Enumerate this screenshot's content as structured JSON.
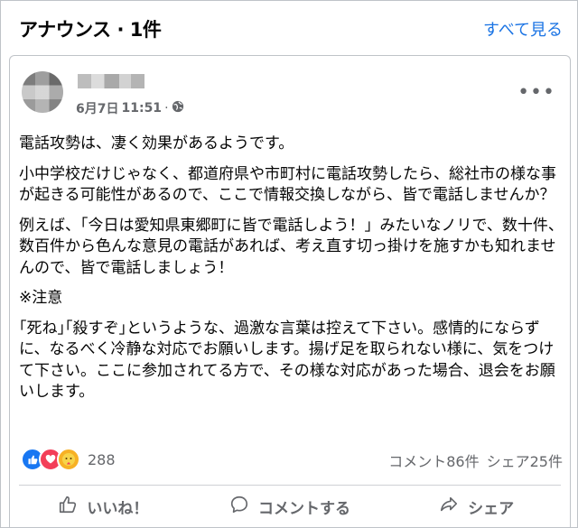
{
  "header": {
    "title": "アナウンス · 1件",
    "see_all": "すべて見る"
  },
  "post": {
    "date": "6月7日",
    "time": "11:51",
    "separator": "·",
    "paragraphs": [
      "電話攻勢は、凄く効果があるようです。",
      "小中学校だけじゃなく、都道府県や市町村に電話攻勢したら、総社市の様な事が起きる可能性があるので、ここで情報交換しながら、皆で電話しませんか？",
      "例えば、「今日は愛知県東郷町に皆で電話しよう！」みたいなノリで、数十件、数百件から色んな意見の電話があれば、考え直す切っ掛けを施すかも知れませんので、皆で電話しましょう！",
      "※注意",
      "｢死ね｣｢殺すぞ｣というような、過激な言葉は控えて下さい。感情的にならずに、なるべく冷静な対応でお願いします。揚げ足を取られない様に、気をつけて下さい。ここに参加されてる方で、その様な対応があった場合、退会をお願いします。"
    ],
    "reaction_count": "288",
    "comments": "コメント86件",
    "shares": "シェア25件"
  },
  "actions": {
    "like": "いいね！",
    "comment": "コメントする",
    "share": "シェア"
  },
  "icons": [
    "globe-icon",
    "more-icon",
    "like-icon",
    "love-icon",
    "care-icon",
    "thumb-up-icon",
    "comment-icon",
    "share-icon"
  ],
  "colors": {
    "link": "#1b74e4",
    "like": "#1877f2",
    "love": "#f33e58",
    "care": "#f7b125",
    "muted": "#65676b"
  }
}
